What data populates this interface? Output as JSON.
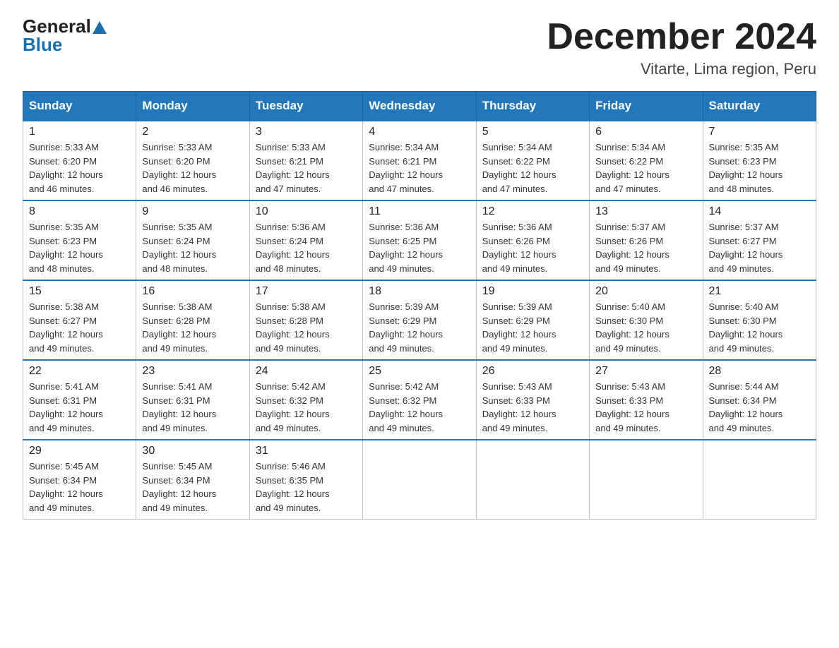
{
  "header": {
    "logo_general": "General",
    "logo_blue": "Blue",
    "title": "December 2024",
    "subtitle": "Vitarte, Lima region, Peru"
  },
  "days_of_week": [
    "Sunday",
    "Monday",
    "Tuesday",
    "Wednesday",
    "Thursday",
    "Friday",
    "Saturday"
  ],
  "weeks": [
    [
      {
        "day": "1",
        "sunrise": "5:33 AM",
        "sunset": "6:20 PM",
        "daylight": "12 hours and 46 minutes."
      },
      {
        "day": "2",
        "sunrise": "5:33 AM",
        "sunset": "6:20 PM",
        "daylight": "12 hours and 46 minutes."
      },
      {
        "day": "3",
        "sunrise": "5:33 AM",
        "sunset": "6:21 PM",
        "daylight": "12 hours and 47 minutes."
      },
      {
        "day": "4",
        "sunrise": "5:34 AM",
        "sunset": "6:21 PM",
        "daylight": "12 hours and 47 minutes."
      },
      {
        "day": "5",
        "sunrise": "5:34 AM",
        "sunset": "6:22 PM",
        "daylight": "12 hours and 47 minutes."
      },
      {
        "day": "6",
        "sunrise": "5:34 AM",
        "sunset": "6:22 PM",
        "daylight": "12 hours and 47 minutes."
      },
      {
        "day": "7",
        "sunrise": "5:35 AM",
        "sunset": "6:23 PM",
        "daylight": "12 hours and 48 minutes."
      }
    ],
    [
      {
        "day": "8",
        "sunrise": "5:35 AM",
        "sunset": "6:23 PM",
        "daylight": "12 hours and 48 minutes."
      },
      {
        "day": "9",
        "sunrise": "5:35 AM",
        "sunset": "6:24 PM",
        "daylight": "12 hours and 48 minutes."
      },
      {
        "day": "10",
        "sunrise": "5:36 AM",
        "sunset": "6:24 PM",
        "daylight": "12 hours and 48 minutes."
      },
      {
        "day": "11",
        "sunrise": "5:36 AM",
        "sunset": "6:25 PM",
        "daylight": "12 hours and 49 minutes."
      },
      {
        "day": "12",
        "sunrise": "5:36 AM",
        "sunset": "6:26 PM",
        "daylight": "12 hours and 49 minutes."
      },
      {
        "day": "13",
        "sunrise": "5:37 AM",
        "sunset": "6:26 PM",
        "daylight": "12 hours and 49 minutes."
      },
      {
        "day": "14",
        "sunrise": "5:37 AM",
        "sunset": "6:27 PM",
        "daylight": "12 hours and 49 minutes."
      }
    ],
    [
      {
        "day": "15",
        "sunrise": "5:38 AM",
        "sunset": "6:27 PM",
        "daylight": "12 hours and 49 minutes."
      },
      {
        "day": "16",
        "sunrise": "5:38 AM",
        "sunset": "6:28 PM",
        "daylight": "12 hours and 49 minutes."
      },
      {
        "day": "17",
        "sunrise": "5:38 AM",
        "sunset": "6:28 PM",
        "daylight": "12 hours and 49 minutes."
      },
      {
        "day": "18",
        "sunrise": "5:39 AM",
        "sunset": "6:29 PM",
        "daylight": "12 hours and 49 minutes."
      },
      {
        "day": "19",
        "sunrise": "5:39 AM",
        "sunset": "6:29 PM",
        "daylight": "12 hours and 49 minutes."
      },
      {
        "day": "20",
        "sunrise": "5:40 AM",
        "sunset": "6:30 PM",
        "daylight": "12 hours and 49 minutes."
      },
      {
        "day": "21",
        "sunrise": "5:40 AM",
        "sunset": "6:30 PM",
        "daylight": "12 hours and 49 minutes."
      }
    ],
    [
      {
        "day": "22",
        "sunrise": "5:41 AM",
        "sunset": "6:31 PM",
        "daylight": "12 hours and 49 minutes."
      },
      {
        "day": "23",
        "sunrise": "5:41 AM",
        "sunset": "6:31 PM",
        "daylight": "12 hours and 49 minutes."
      },
      {
        "day": "24",
        "sunrise": "5:42 AM",
        "sunset": "6:32 PM",
        "daylight": "12 hours and 49 minutes."
      },
      {
        "day": "25",
        "sunrise": "5:42 AM",
        "sunset": "6:32 PM",
        "daylight": "12 hours and 49 minutes."
      },
      {
        "day": "26",
        "sunrise": "5:43 AM",
        "sunset": "6:33 PM",
        "daylight": "12 hours and 49 minutes."
      },
      {
        "day": "27",
        "sunrise": "5:43 AM",
        "sunset": "6:33 PM",
        "daylight": "12 hours and 49 minutes."
      },
      {
        "day": "28",
        "sunrise": "5:44 AM",
        "sunset": "6:34 PM",
        "daylight": "12 hours and 49 minutes."
      }
    ],
    [
      {
        "day": "29",
        "sunrise": "5:45 AM",
        "sunset": "6:34 PM",
        "daylight": "12 hours and 49 minutes."
      },
      {
        "day": "30",
        "sunrise": "5:45 AM",
        "sunset": "6:34 PM",
        "daylight": "12 hours and 49 minutes."
      },
      {
        "day": "31",
        "sunrise": "5:46 AM",
        "sunset": "6:35 PM",
        "daylight": "12 hours and 49 minutes."
      },
      null,
      null,
      null,
      null
    ]
  ],
  "labels": {
    "sunrise": "Sunrise:",
    "sunset": "Sunset:",
    "daylight": "Daylight:"
  }
}
